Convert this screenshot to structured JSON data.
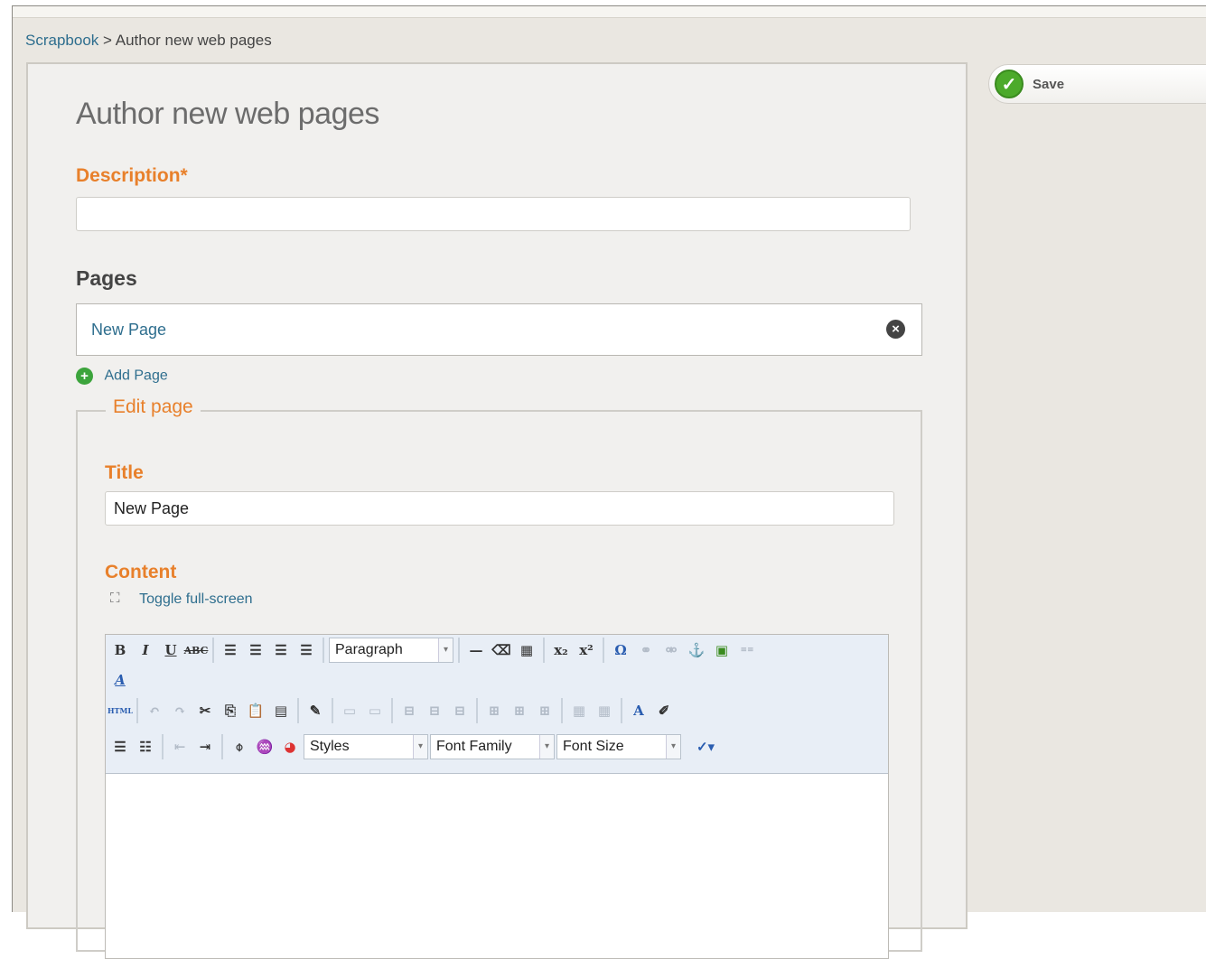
{
  "breadcrumb": {
    "root": "Scrapbook",
    "separator": ">",
    "current": "Author new web pages"
  },
  "title": "Author new web pages",
  "description": {
    "label": "Description*",
    "value": ""
  },
  "pages": {
    "heading": "Pages",
    "items": [
      {
        "label": "New Page"
      }
    ],
    "add_label": "Add Page"
  },
  "edit_page": {
    "legend": "Edit page",
    "title_label": "Title",
    "title_value": "New Page",
    "content_label": "Content",
    "toggle_fullscreen": "Toggle full-screen"
  },
  "toolbar": {
    "format_select": "Paragraph",
    "styles_select": "Styles",
    "font_family_select": "Font Family",
    "font_size_select": "Font Size"
  },
  "actions": {
    "save_label": "Save"
  },
  "colors": {
    "accent": "#e8802b",
    "link": "#2e6e8e",
    "save_green": "#4caa2b"
  }
}
